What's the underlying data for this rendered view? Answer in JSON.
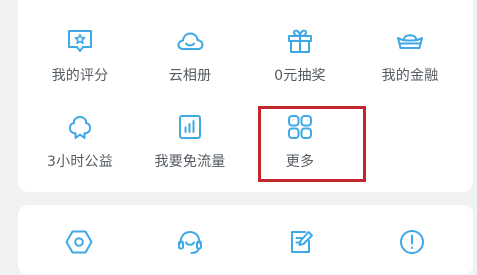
{
  "colors": {
    "icon_blue": "#3fa9e6",
    "label_gray": "#555b61",
    "highlight_red": "#c0262b",
    "background": "#f1f2f4",
    "card": "#ffffff"
  },
  "grid": {
    "row1": [
      {
        "label": "我的评分",
        "icon": "rating-icon"
      },
      {
        "label": "云相册",
        "icon": "cloud-album-icon"
      },
      {
        "label": "0元抽奖",
        "icon": "gift-icon"
      },
      {
        "label": "我的金融",
        "icon": "gold-ingot-icon"
      }
    ],
    "row2": [
      {
        "label": "3小时公益",
        "icon": "charity-icon"
      },
      {
        "label": "我要免流量",
        "icon": "data-plan-icon"
      },
      {
        "label": "更多",
        "icon": "more-grid-icon",
        "highlighted": true
      }
    ]
  },
  "bottom_icons": [
    {
      "icon": "settings-hexagon-icon"
    },
    {
      "icon": "customer-service-icon"
    },
    {
      "icon": "feedback-edit-icon"
    },
    {
      "icon": "about-info-icon"
    }
  ]
}
